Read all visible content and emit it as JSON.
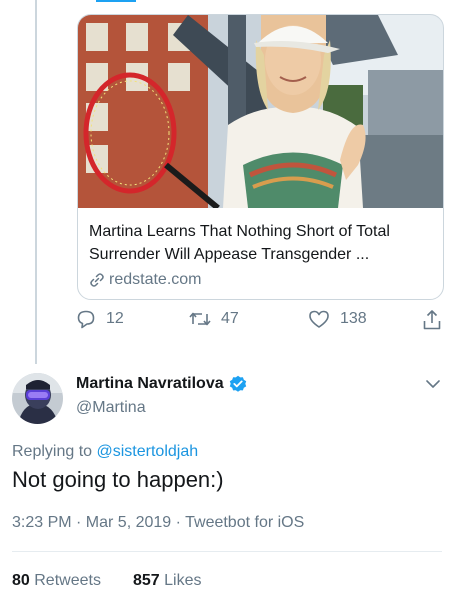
{
  "card": {
    "title": "Martina Learns That Nothing Short of Total Surrender Will Appease Transgender ...",
    "domain": "redstate.com"
  },
  "actions": {
    "replies": "12",
    "retweets": "47",
    "likes": "138"
  },
  "tweet": {
    "display_name": "Martina Navratilova",
    "handle": "@Martina",
    "replying_prefix": "Replying to",
    "replying_to": "@sistertoldjah",
    "text": "Not going to happen:)",
    "timestamp": "3:23 PM · Mar 5, 2019 · Tweetbot for iOS",
    "retweet_count": "80",
    "retweet_label": "Retweets",
    "like_count": "857",
    "like_label": "Likes"
  },
  "colors": {
    "accent": "#1da1f2",
    "link": "#1b95e0",
    "secondary_text": "#657786",
    "verified": "#1da1f2"
  },
  "icons": [
    "link-icon",
    "reply-icon",
    "retweet-icon",
    "like-icon",
    "share-icon",
    "verified-badge-icon",
    "chevron-down-icon"
  ]
}
